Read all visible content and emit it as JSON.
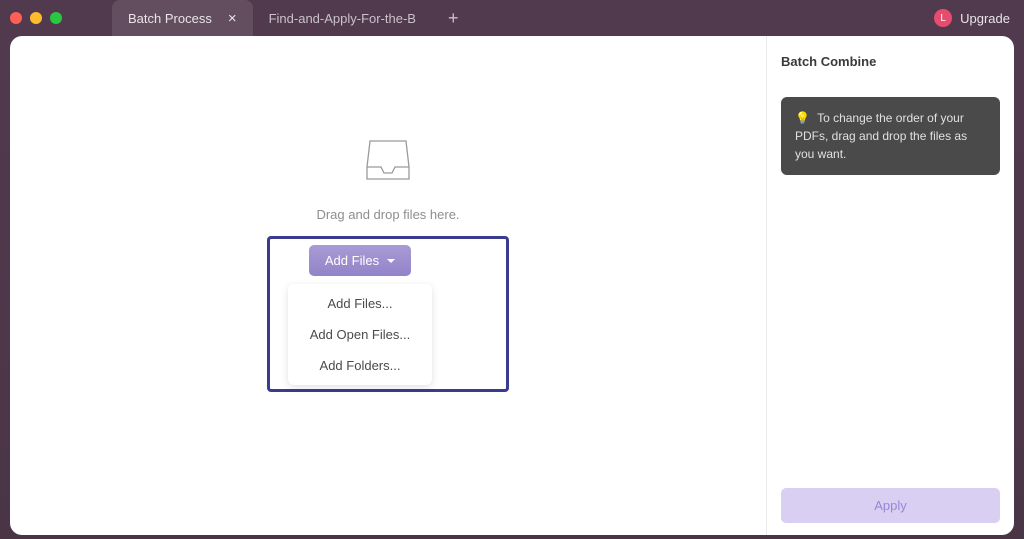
{
  "tabs": [
    {
      "label": "Batch Process",
      "active": true,
      "closable": true
    },
    {
      "label": "Find-and-Apply-For-the-B",
      "active": false,
      "closable": false
    }
  ],
  "avatar_letter": "L",
  "upgrade_label": "Upgrade",
  "main": {
    "drop_text": "Drag and drop files here.",
    "add_button": "Add Files",
    "menu": {
      "add_files": "Add Files...",
      "add_open_files": "Add Open Files...",
      "add_folders": "Add Folders..."
    }
  },
  "sidebar": {
    "title": "Batch Combine",
    "tip_emoji": "💡",
    "tip_text": "To change the order of your PDFs, drag and drop the files as you want.",
    "apply_label": "Apply"
  }
}
